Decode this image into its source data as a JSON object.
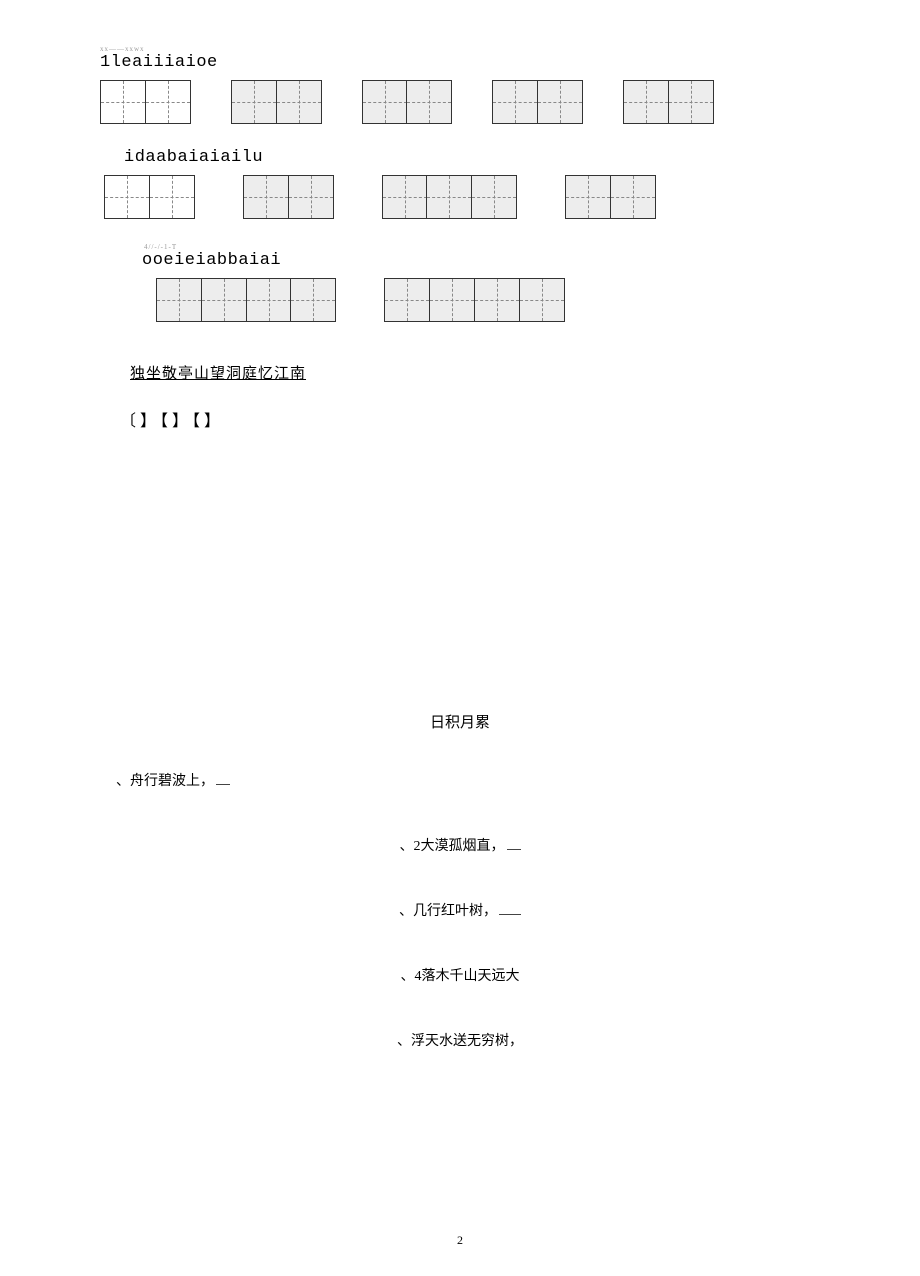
{
  "tiny_labels": {
    "a": "xx——xxwx",
    "b": "4//-/-1-T"
  },
  "pinyin": {
    "line1": "1leaiiiaioe",
    "line2": "idaabaiaiailu",
    "line3": "ooeieiabbaiai"
  },
  "underline_title": "独坐敬亭山望洞庭忆江南",
  "brackets": "〔】【】【】",
  "section_title": "日积月累",
  "poems": {
    "p1": "、舟行碧波上，",
    "p2": "、2大漠孤烟直，",
    "p3": "、几行红叶树，",
    "p4": "、4落木千山天远大",
    "p5": "、浮天水送无穷树，"
  },
  "page_number": "2"
}
